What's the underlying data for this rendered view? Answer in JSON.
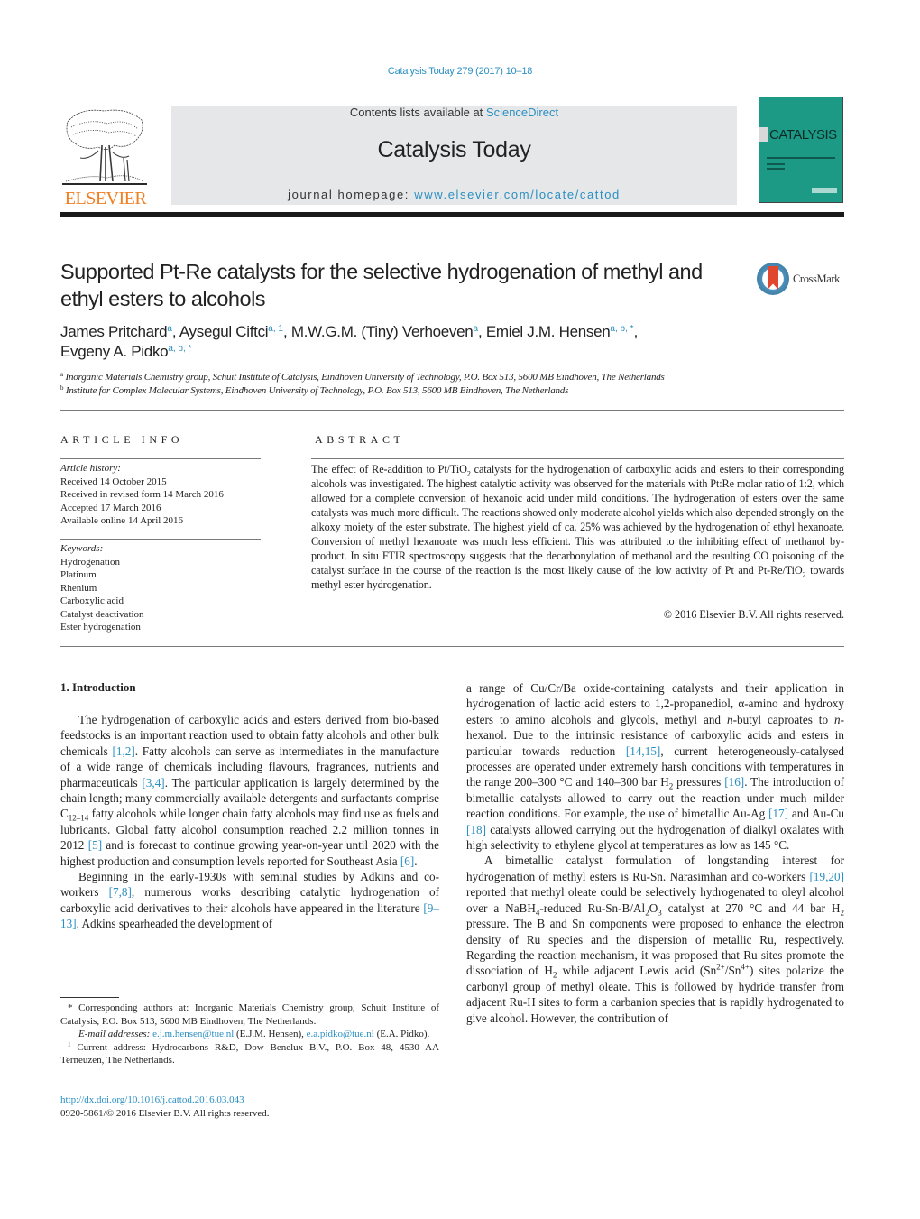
{
  "header": {
    "journal_ref": "Catalysis Today 279 (2017) 10–18",
    "publisher_name": "ELSEVIER",
    "contents_prefix": "Contents lists available at ",
    "contents_link": "ScienceDirect",
    "journal_title": "Catalysis Today",
    "homepage_prefix": "journal homepage: ",
    "homepage_link": "www.elsevier.com/locate/cattod",
    "cover_title": "CATALYSIS",
    "crossmark_label": "CrossMark"
  },
  "colors": {
    "link": "#2a8fc2",
    "elsevier_orange": "#f07f22",
    "masthead_bg": "#e6e7e8",
    "cover_teal": "#1c9a86",
    "crossmark_red": "#e0472e"
  },
  "article": {
    "title": "Supported Pt-Re catalysts for the selective hydrogenation of methyl and ethyl esters to alcohols",
    "authors": [
      {
        "name": "James Pritchard",
        "sup": "a",
        "sep": ", "
      },
      {
        "name": "Aysegul Ciftci",
        "sup": "a, 1",
        "sep": ", "
      },
      {
        "name": "M.W.G.M. (Tiny) Verhoeven",
        "sup": "a",
        "sep": ", "
      },
      {
        "name": "Emiel J.M. Hensen",
        "sup": "a, b, *",
        "sep": ","
      },
      {
        "name": "Evgeny A. Pidko",
        "sup": "a, b, *",
        "sep": ""
      }
    ],
    "affiliations": [
      {
        "key": "a",
        "text": "Inorganic Materials Chemistry group, Schuit Institute of Catalysis, Eindhoven University of Technology, P.O. Box 513, 5600 MB Eindhoven, The Netherlands"
      },
      {
        "key": "b",
        "text": "Institute for Complex Molecular Systems, Eindhoven University of Technology, P.O. Box 513, 5600 MB Eindhoven, The Netherlands"
      }
    ]
  },
  "article_info": {
    "heading": "ARTICLE INFO",
    "history_label": "Article history:",
    "history": [
      "Received 14 October 2015",
      "Received in revised form 14 March 2016",
      "Accepted 17 March 2016",
      "Available online 14 April 2016"
    ],
    "keywords_label": "Keywords:",
    "keywords": [
      "Hydrogenation",
      "Platinum",
      "Rhenium",
      "Carboxylic acid",
      "Catalyst deactivation",
      "Ester hydrogenation"
    ]
  },
  "abstract": {
    "heading": "ABSTRACT",
    "parts": {
      "p1": "The effect of Re-addition to Pt/TiO",
      "s1": "2",
      "p2": " catalysts for the hydrogenation of carboxylic acids and esters to their corresponding alcohols was investigated. The highest catalytic activity was observed for the materials with Pt:Re molar ratio of 1:2, which allowed for a complete conversion of hexanoic acid under mild conditions. The hydrogenation of esters over the same catalysts was much more difficult. The reactions showed only moderate alcohol yields which also depended strongly on the alkoxy moiety of the ester substrate. The highest yield of ca. 25% was achieved by the hydrogenation of ethyl hexanoate. Conversion of methyl hexanoate was much less efficient. This was attributed to the inhibiting effect of methanol by-product. In situ FTIR spectroscopy suggests that the decarbonylation of methanol and the resulting CO poisoning of the catalyst surface in the course of the reaction is the most likely cause of the low activity of Pt and Pt-Re/TiO",
      "s2": "2",
      "p3": " towards methyl ester hydrogenation."
    },
    "copyright": "© 2016 Elsevier B.V. All rights reserved."
  },
  "body": {
    "section_heading": "1.  Introduction",
    "left": {
      "p1": {
        "t1": "The hydrogenation of carboxylic acids and esters derived from bio-based feedstocks is an important reaction used to obtain fatty alcohols and other bulk chemicals ",
        "r1": "[1,2]",
        "t2": ". Fatty alcohols can serve as intermediates in the manufacture of a wide range of chemicals including flavours, fragrances, nutrients and pharmaceuticals ",
        "r2": "[3,4]",
        "t3": ". The particular application is largely determined by the chain length; many commercially available detergents and surfactants comprise C",
        "sub1": "12–14",
        "t4": " fatty alcohols while longer chain fatty alcohols may find use as fuels and lubricants. Global fatty alcohol consumption reached 2.2 million tonnes in 2012 ",
        "r3": "[5]",
        "t5": " and is forecast to continue growing year-on-year until 2020 with the highest production and consumption levels reported for Southeast Asia ",
        "r4": "[6]",
        "t6": "."
      },
      "p2": {
        "t1": "Beginning in the early-1930s with seminal studies by Adkins and co-workers ",
        "r1": "[7,8]",
        "t2": ", numerous works describing catalytic hydrogenation of carboxylic acid derivatives to their alcohols have appeared in the literature ",
        "r2": "[9–13]",
        "t3": ". Adkins spearheaded the development of"
      }
    },
    "right": {
      "p1": {
        "t1": "a range of Cu/Cr/Ba oxide-containing catalysts and their application in hydrogenation of lactic acid esters to 1,2-propanediol, α-amino and hydroxy esters to amino alcohols and glycols, methyl and ",
        "i1": "n",
        "t2": "-butyl caproates to ",
        "i2": "n",
        "t3": "-hexanol. Due to the intrinsic resistance of carboxylic acids and esters in particular towards reduction ",
        "r1": "[14,15]",
        "t4": ", current heterogeneously-catalysed processes are operated under extremely harsh conditions with temperatures in the range 200–300 °C and 140–300 bar H",
        "sub1": "2",
        "t5": " pressures ",
        "r2": "[16]",
        "t6": ". The introduction of bimetallic catalysts allowed to carry out the reaction under much milder reaction conditions. For example, the use of bimetallic Au-Ag ",
        "r3": "[17]",
        "t7": " and Au-Cu ",
        "r4": "[18]",
        "t8": " catalysts allowed carrying out the hydrogenation of dialkyl oxalates with high selectivity to ethylene glycol at temperatures as low as 145 °C."
      },
      "p2": {
        "t1": "A bimetallic catalyst formulation of longstanding interest for hydrogenation of methyl esters is Ru-Sn. Narasimhan and co-workers ",
        "r1": "[19,20]",
        "t2": " reported that methyl oleate could be selectively hydrogenated to oleyl alcohol over a NaBH",
        "sub1": "4",
        "t3": "-reduced Ru-Sn-B/Al",
        "sub2": "2",
        "t4": "O",
        "sub3": "3",
        "t5": " catalyst at 270 °C and 44 bar H",
        "sub4": "2",
        "t6": " pressure. The B and Sn components were proposed to enhance the electron density of Ru species and the dispersion of metallic Ru, respectively. Regarding the reaction mechanism, it was proposed that Ru sites promote the dissociation of H",
        "sub5": "2",
        "t7": " while adjacent Lewis acid (Sn",
        "sup1": "2+",
        "t8": "/Sn",
        "sup2": "4+",
        "t9": ") sites polarize the carbonyl group of methyl oleate. This is followed by hydride transfer from adjacent Ru-H sites to form a carbanion species that is rapidly hydrogenated to give alcohol. However, the contribution of"
      }
    }
  },
  "footnotes": {
    "corresponding_mark": "*",
    "corresponding": " Corresponding authors at: Inorganic Materials Chemistry group, Schuit Institute of Catalysis, P.O. Box 513, 5600 MB Eindhoven, The Netherlands.",
    "email_label": "E-mail addresses: ",
    "email1": "e.j.m.hensen@tue.nl",
    "email1_owner": " (E.J.M. Hensen), ",
    "email2": "e.a.pidko@tue.nl",
    "email2_owner": " (E.A. Pidko).",
    "current_mark": "1",
    "current_address": " Current address: Hydrocarbons R&D, Dow Benelux B.V., P.O. Box 48, 4530 AA Terneuzen, The Netherlands.",
    "doi": "http://dx.doi.org/10.1016/j.cattod.2016.03.043",
    "issn_copyright": "0920-5861/© 2016 Elsevier B.V. All rights reserved."
  }
}
